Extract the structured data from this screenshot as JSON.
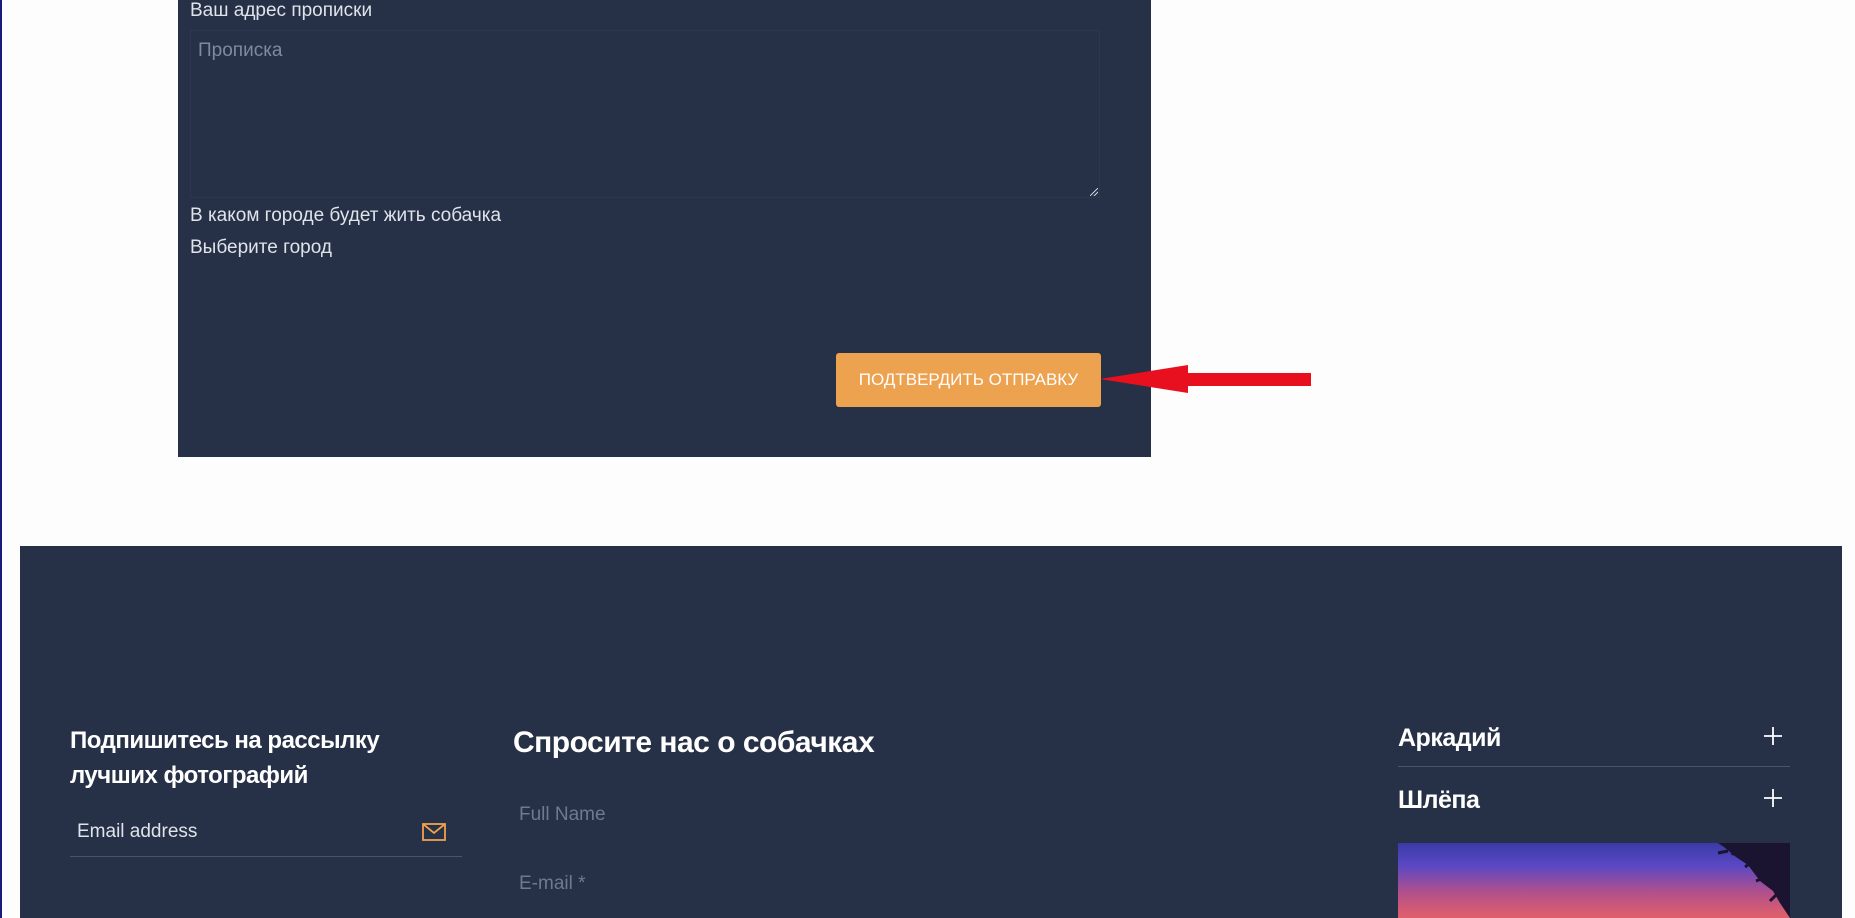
{
  "form": {
    "address_label": "Ваш адрес прописки",
    "address_placeholder": "Прописка",
    "address_value": "",
    "city_label": "В каком городе будет жить собачка",
    "city_selected": "Выберите город",
    "submit_label": "ПОДТВЕРДИТЬ ОТПРАВКУ"
  },
  "footer": {
    "subscribe_title": "Подпишитесь на рассылку лучших фотографий",
    "email_placeholder": "Email address",
    "ask_title": "Спросите нас о собачках",
    "fullname_placeholder": "Full Name",
    "email_field_placeholder": "E-mail *",
    "accordion": [
      {
        "label": "Аркадий"
      },
      {
        "label": "Шлёпа"
      }
    ]
  },
  "colors": {
    "panel_bg": "#263046",
    "accent": "#eda24f",
    "annotation_arrow": "#e8101e"
  },
  "icons": {
    "mail": "mail-icon",
    "plus": "plus-icon",
    "arrow": "arrow-left-icon"
  }
}
